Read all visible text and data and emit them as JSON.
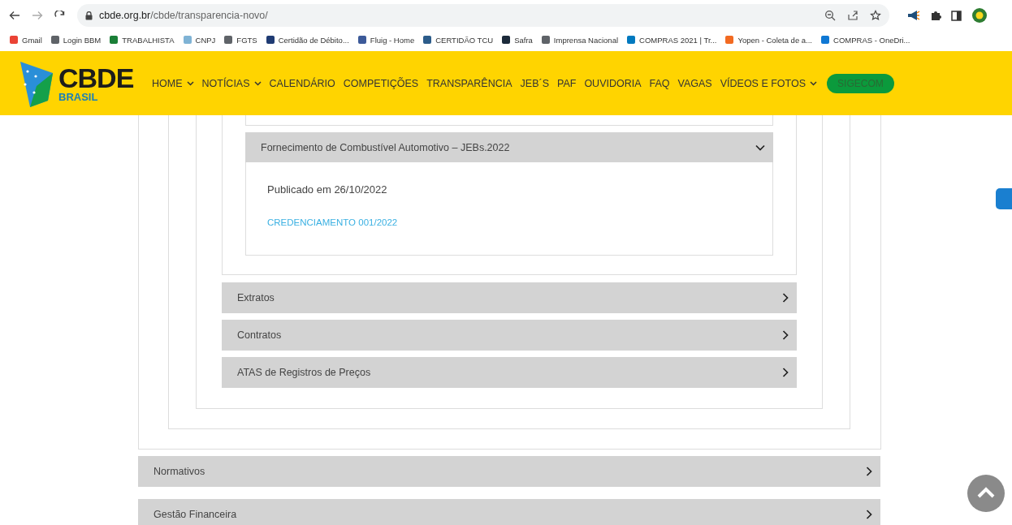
{
  "browser": {
    "url_host": "cbde.org.br",
    "url_path": "/cbde/transparencia-novo/",
    "bookmarks": [
      {
        "label": "Gmail",
        "color": "#ea4335"
      },
      {
        "label": "Login BBM",
        "color": "#5f6368"
      },
      {
        "label": "TRABALHISTA",
        "color": "#1a7f37"
      },
      {
        "label": "CNPJ",
        "color": "#7fb3d5"
      },
      {
        "label": "FGTS",
        "color": "#5f6368"
      },
      {
        "label": "Certidão de Débito...",
        "color": "#1f3b73"
      },
      {
        "label": "Fluig - Home",
        "color": "#3c5a99"
      },
      {
        "label": "CERTIDÃO TCU",
        "color": "#2c5c8a"
      },
      {
        "label": "Safra",
        "color": "#1c2a3a"
      },
      {
        "label": "Imprensa Nacional",
        "color": "#5f6368"
      },
      {
        "label": "COMPRAS 2021 | Tr...",
        "color": "#0079bf"
      },
      {
        "label": "Yopen - Coleta de a...",
        "color": "#f26a21"
      },
      {
        "label": "COMPRAS - OneDri...",
        "color": "#0f78d4"
      }
    ]
  },
  "header": {
    "logo_title": "CBDE",
    "logo_subtitle": "BRASIL",
    "nav": [
      {
        "label": "HOME",
        "dropdown": true
      },
      {
        "label": "NOTÍCIAS",
        "dropdown": true
      },
      {
        "label": "CALENDÁRIO",
        "dropdown": false
      },
      {
        "label": "COMPETIÇÕES",
        "dropdown": false
      },
      {
        "label": "TRANSPARÊNCIA",
        "dropdown": false
      },
      {
        "label": "JEB´S",
        "dropdown": false
      },
      {
        "label": "PAF",
        "dropdown": false
      },
      {
        "label": "OUVIDORIA",
        "dropdown": false
      },
      {
        "label": "FAQ",
        "dropdown": false
      },
      {
        "label": "VAGAS",
        "dropdown": false
      },
      {
        "label": "VÍDEOS E FOTOS",
        "dropdown": true
      }
    ],
    "button": "SIGECOM"
  },
  "open_item": {
    "title": "Fornecimento de Combustível Automotivo – JEBs.2022",
    "expanded": true,
    "published": "Publicado em 26/10/2022",
    "link": "CREDENCIAMENTO 001/2022"
  },
  "sections": [
    {
      "title": "Extratos",
      "expanded": false
    },
    {
      "title": "Contratos",
      "expanded": false
    },
    {
      "title": "ATAS de Registros de Preços",
      "expanded": false
    }
  ],
  "outer_sections": [
    {
      "title": "Normativos",
      "expanded": false
    },
    {
      "title": "Gestão Financeira",
      "expanded": false
    }
  ]
}
